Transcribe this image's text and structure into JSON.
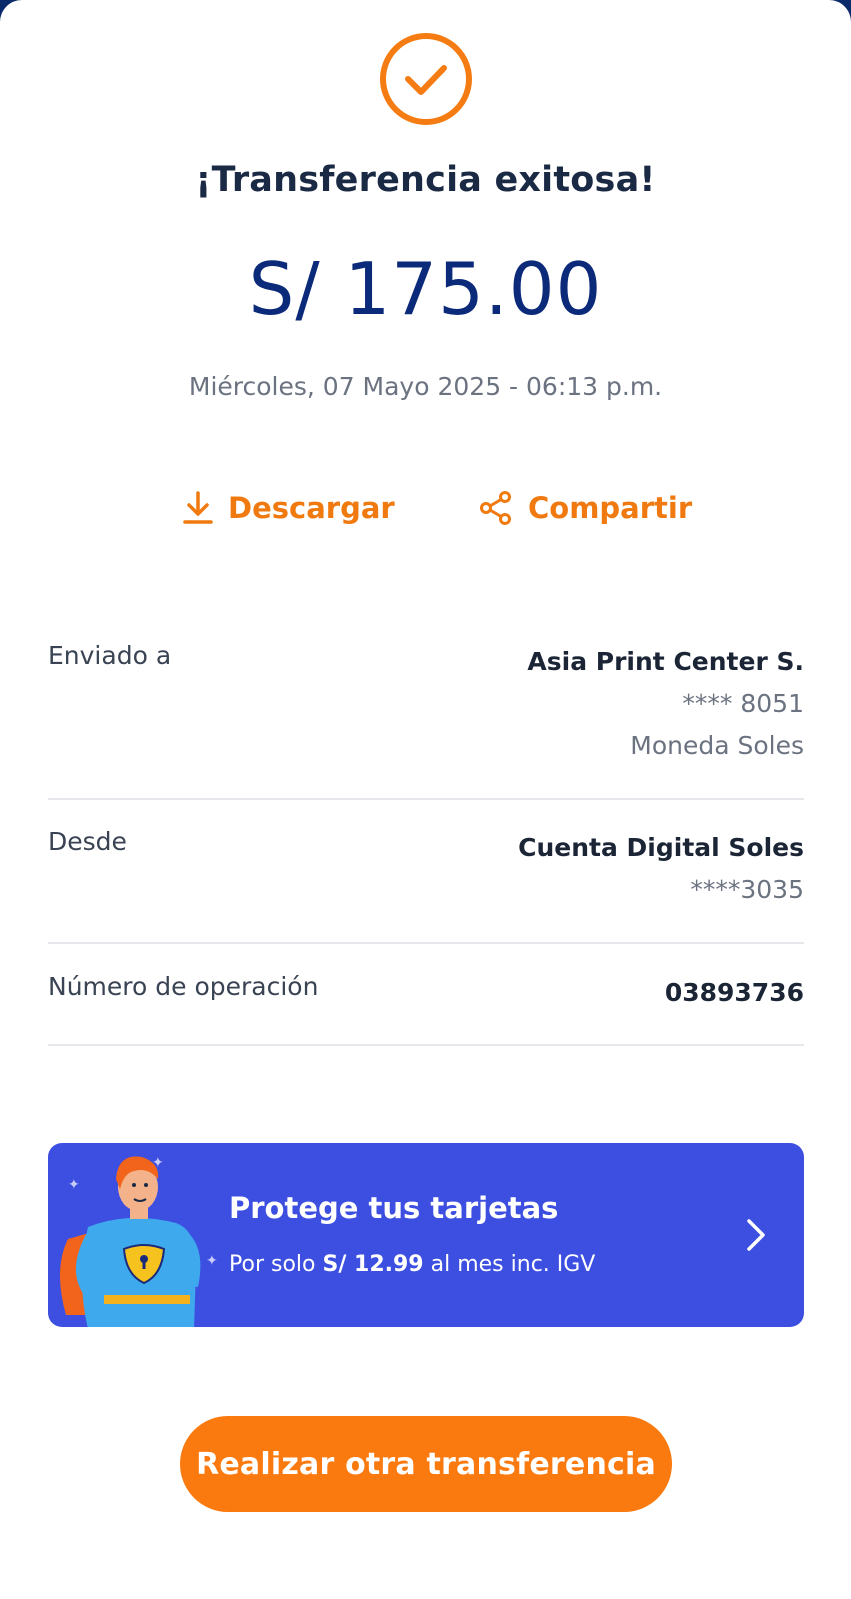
{
  "header": {
    "success_icon": "check-circle-icon",
    "title": "¡Transferencia exitosa!",
    "amount": "S/ 175.00",
    "datetime": "Miércoles, 07 Mayo 2025 - 06:13 p.m."
  },
  "actions": {
    "download_label": "Descargar",
    "download_icon": "download-icon",
    "share_label": "Compartir",
    "share_icon": "share-icon"
  },
  "details": {
    "sent_to": {
      "label": "Enviado a",
      "name": "Asia Print Center S.",
      "account": "**** 8051",
      "currency": "Moneda Soles"
    },
    "from": {
      "label": "Desde",
      "account_name": "Cuenta Digital Soles",
      "account": "****3035"
    },
    "operation": {
      "label": "Número de operación",
      "value": "03893736"
    }
  },
  "promo": {
    "title": "Protege tus tarjetas",
    "sub_prefix": "Por solo",
    "price": "S/ 12.99",
    "sub_suffix": "al mes inc. IGV",
    "chevron_icon": "chevron-right-icon"
  },
  "cta": {
    "label": "Realizar otra transferencia"
  },
  "colors": {
    "accent": "#fb7a10",
    "amount": "#0b2a7a",
    "promo_bg": "#3d4fe0"
  }
}
